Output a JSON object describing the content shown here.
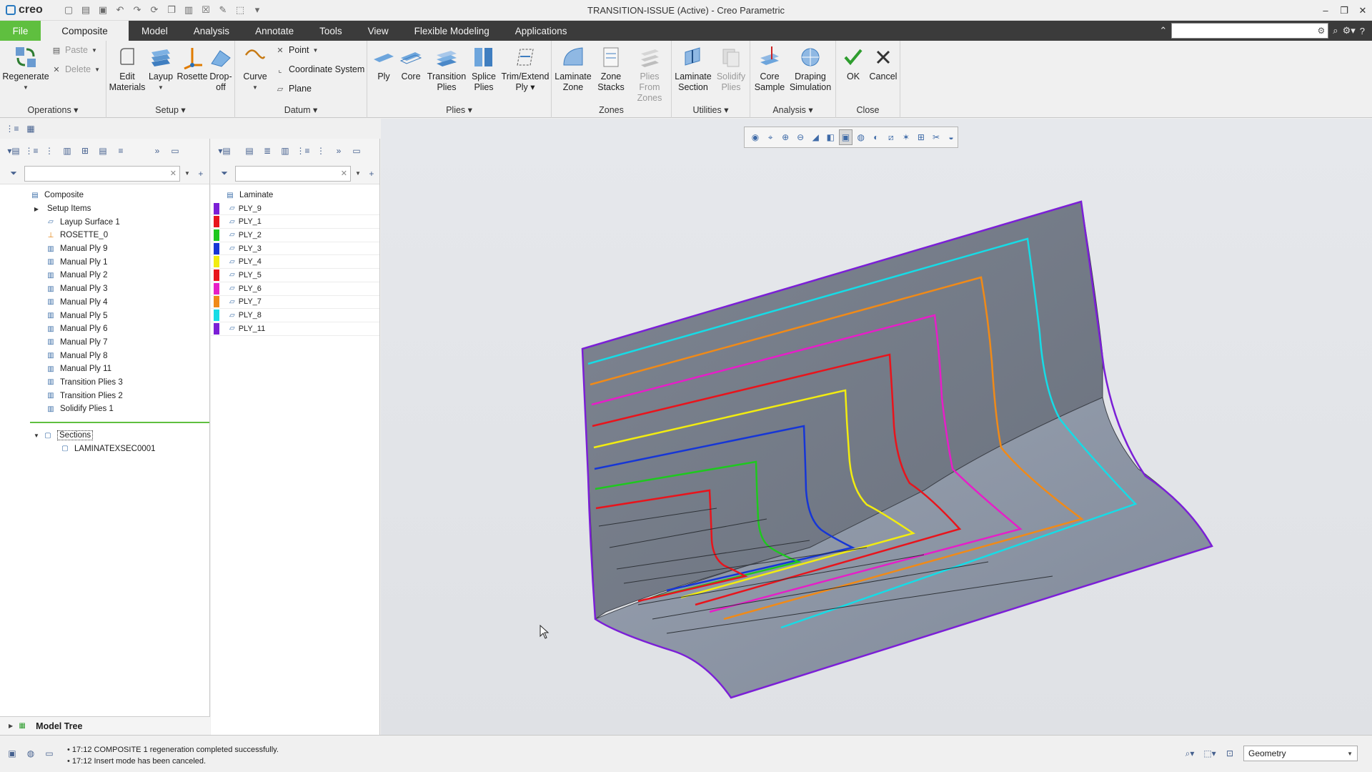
{
  "app": {
    "logo_text": "creo",
    "window_title": "TRANSITION-ISSUE (Active) - Creo Parametric"
  },
  "tabs": [
    "File",
    "Composite",
    "Model",
    "Analysis",
    "Annotate",
    "Tools",
    "View",
    "Flexible Modeling",
    "Applications"
  ],
  "ribbon": {
    "operations": {
      "label": "Operations",
      "regenerate": "Regenerate",
      "paste": "Paste",
      "delete": "Delete"
    },
    "setup": {
      "label": "Setup",
      "edit_materials_1": "Edit",
      "edit_materials_2": "Materials",
      "layup": "Layup",
      "rosette": "Rosette",
      "dropoff_1": "Drop-",
      "dropoff_2": "off"
    },
    "datum": {
      "label": "Datum",
      "curve": "Curve",
      "point": "Point",
      "coordinate_system": "Coordinate System",
      "plane": "Plane"
    },
    "plies": {
      "label": "Plies",
      "ply": "Ply",
      "core": "Core",
      "transition_1": "Transition",
      "transition_2": "Plies",
      "splice_1": "Splice",
      "splice_2": "Plies",
      "trim_1": "Trim/Extend",
      "trim_2": "Ply"
    },
    "zones": {
      "label": "Zones",
      "laminate_zone_1": "Laminate",
      "laminate_zone_2": "Zone",
      "zone_stacks_1": "Zone",
      "zone_stacks_2": "Stacks",
      "plies_from_zones_1": "Plies From",
      "plies_from_zones_2": "Zones"
    },
    "utilities": {
      "label": "Utilities",
      "laminate_section_1": "Laminate",
      "laminate_section_2": "Section",
      "solidify_1": "Solidify",
      "solidify_2": "Plies"
    },
    "analysis": {
      "label": "Analysis",
      "core_sample_1": "Core",
      "core_sample_2": "Sample",
      "draping_1": "Draping",
      "draping_2": "Simulation"
    },
    "close": {
      "label": "Close",
      "ok": "OK",
      "cancel": "Cancel"
    }
  },
  "model_tree": {
    "root": "Composite",
    "items": [
      "Setup Items",
      "Layup Surface 1",
      "ROSETTE_0",
      "Manual Ply 9",
      "Manual Ply 1",
      "Manual Ply 2",
      "Manual Ply 3",
      "Manual Ply 4",
      "Manual Ply 5",
      "Manual Ply 6",
      "Manual Ply 7",
      "Manual Ply 8",
      "Manual Ply 11",
      "Transition Plies 3",
      "Transition Plies 2",
      "Solidify Plies 1"
    ],
    "sections": "Sections",
    "section_item": "LAMINATEXSEC0001",
    "footer": "Model Tree"
  },
  "laminate_tree": {
    "root": "Laminate",
    "plies": [
      {
        "name": "PLY_9",
        "color": "#7b1fd6"
      },
      {
        "name": "PLY_1",
        "color": "#e8141c"
      },
      {
        "name": "PLY_2",
        "color": "#1ec81e"
      },
      {
        "name": "PLY_3",
        "color": "#1636d6"
      },
      {
        "name": "PLY_4",
        "color": "#f2ec10"
      },
      {
        "name": "PLY_5",
        "color": "#e8141c"
      },
      {
        "name": "PLY_6",
        "color": "#e61ec8"
      },
      {
        "name": "PLY_7",
        "color": "#f08a18"
      },
      {
        "name": "PLY_8",
        "color": "#16dce6"
      },
      {
        "name": "PLY_11",
        "color": "#7b1fd6"
      }
    ]
  },
  "status": {
    "messages": [
      "17:12 COMPOSITE 1 regeneration completed successfully.",
      "17:12 Insert mode has been canceled."
    ],
    "filter_value": "Geometry"
  },
  "icons": [
    "search-icon",
    "gear-icon",
    "close-icon",
    "filter-icon",
    "plus-icon",
    "chevron-down-icon"
  ]
}
